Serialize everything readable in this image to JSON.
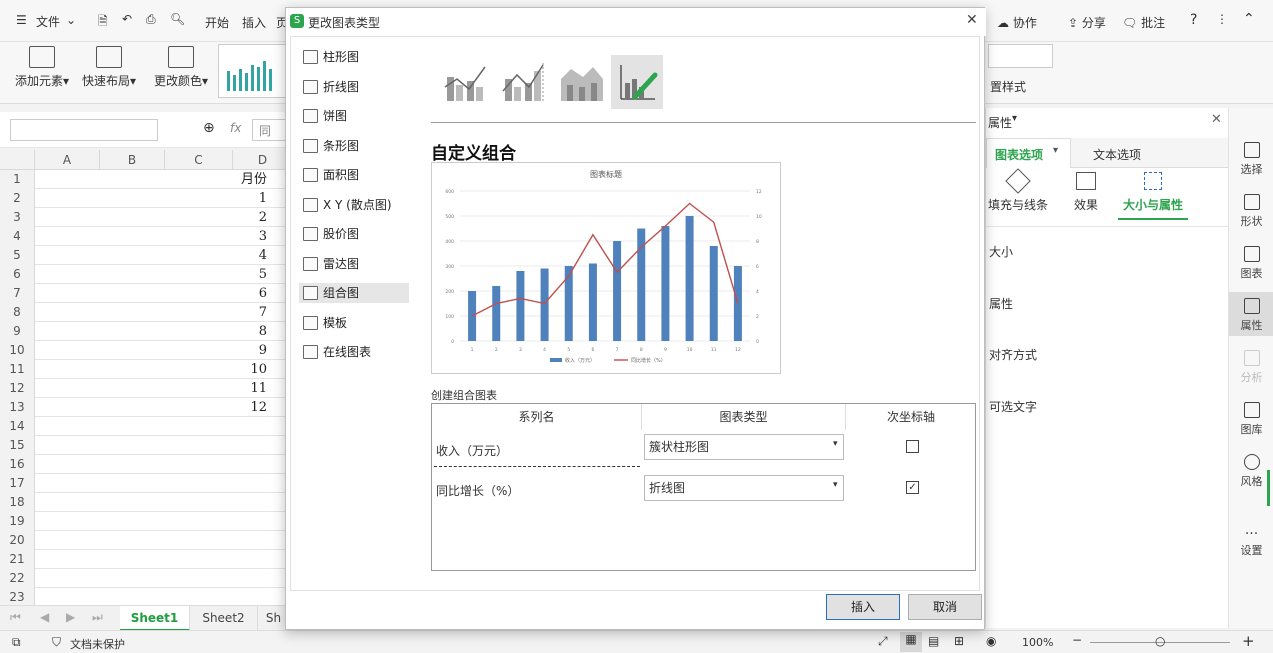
{
  "topbar": {
    "menu_label": "文件",
    "tab_start": "开始",
    "tab_insert": "插入",
    "tab_page_cut": "页",
    "collab_label": "协作",
    "share_label": "分享",
    "annotate_label": "批注"
  },
  "ribbon": {
    "add_element": "添加元素",
    "quick_layout": "快速布局",
    "change_color": "更改颜色",
    "style_label": "置样式"
  },
  "formula": {
    "fx": "fx",
    "partial_text": "同"
  },
  "sheet": {
    "columns": [
      "A",
      "B",
      "C",
      "D"
    ],
    "header_cell": "月份",
    "rows": [
      "1",
      "2",
      "3",
      "4",
      "5",
      "6",
      "7",
      "8",
      "9",
      "10",
      "11",
      "12",
      "13",
      "14",
      "15",
      "16",
      "17",
      "18",
      "19",
      "20",
      "21",
      "22",
      "23"
    ],
    "d_values": [
      "月份",
      "1",
      "2",
      "3",
      "4",
      "5",
      "6",
      "7",
      "8",
      "9",
      "10",
      "11",
      "12"
    ],
    "tabs": [
      "Sheet1",
      "Sheet2",
      "Sh"
    ]
  },
  "status": {
    "doc_protect": "文档未保护",
    "zoom": "100%"
  },
  "right_panel": {
    "title": "属性",
    "tab_chart": "图表选项",
    "tab_text": "文本选项",
    "sub_fill": "填充与线条",
    "sub_effect": "效果",
    "sub_size": "大小与属性",
    "section_size": "大小",
    "section_prop": "属性",
    "section_align": "对齐方式",
    "section_alt": "可选文字"
  },
  "side": {
    "select": "选择",
    "shape": "形状",
    "chart": "图表",
    "prop": "属性",
    "analyze": "分析",
    "gallery": "图库",
    "style": "风格",
    "settings": "设置"
  },
  "dialog": {
    "title": "更改图表类型",
    "categories": [
      "柱形图",
      "折线图",
      "饼图",
      "条形图",
      "面积图",
      "X Y (散点图)",
      "股价图",
      "雷达图",
      "组合图",
      "模板",
      "在线图表"
    ],
    "selected_category": "组合图",
    "section_title": "自定义组合",
    "create_label": "创建组合图表",
    "table_headers": [
      "系列名",
      "图表类型",
      "次坐标轴"
    ],
    "series": [
      {
        "name": "收入（万元）",
        "type": "簇状柱形图",
        "secondary": false
      },
      {
        "name": "同比增长（%）",
        "type": "折线图",
        "secondary": true
      }
    ],
    "insert_btn": "插入",
    "cancel_btn": "取消"
  },
  "chart_data": {
    "type": "bar",
    "title": "图表标题",
    "categories": [
      "1",
      "2",
      "3",
      "4",
      "5",
      "6",
      "7",
      "8",
      "9",
      "10",
      "11",
      "12"
    ],
    "series": [
      {
        "name": "收入（万元）",
        "type": "bar",
        "axis": "primary",
        "values": [
          200,
          220,
          280,
          290,
          300,
          310,
          400,
          450,
          460,
          500,
          380,
          300
        ]
      },
      {
        "name": "同比增长（%）",
        "type": "line",
        "axis": "secondary",
        "values": [
          2,
          3,
          3.4,
          3,
          5.2,
          8.5,
          5.5,
          7.5,
          9.2,
          11,
          9.5,
          3
        ]
      }
    ],
    "y_primary": {
      "ticks": [
        0,
        100,
        200,
        300,
        400,
        500,
        600
      ],
      "lim": [
        0,
        600
      ]
    },
    "y_secondary": {
      "ticks": [
        0,
        2,
        4,
        6,
        8,
        10,
        12
      ],
      "lim": [
        0,
        12
      ]
    },
    "grid": true,
    "legend": "bottom",
    "colors": {
      "bar": "#4f81bd",
      "line": "#c0504d"
    }
  },
  "colors": {
    "accent_green": "#2da44e",
    "selected_tab": "#217346"
  }
}
